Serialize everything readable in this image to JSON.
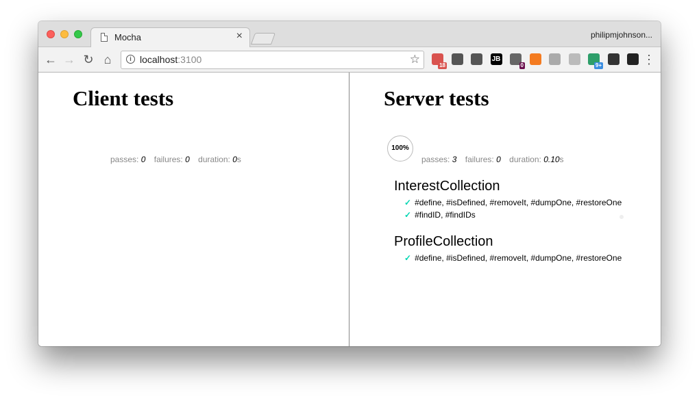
{
  "browser": {
    "tab_title": "Mocha",
    "tab_close": "×",
    "profile_name": "philipmjohnson...",
    "url_host": "localhost",
    "url_port": ":3100",
    "nav": {
      "back": "←",
      "forward": "→",
      "reload": "↻",
      "home": "⌂"
    },
    "star": "☆",
    "menu": "⋮",
    "extensions": [
      {
        "name": "ext-1-icon",
        "badge": "18",
        "color": "#d9534f"
      },
      {
        "name": "ext-2-icon",
        "badge": "",
        "color": "#555555"
      },
      {
        "name": "ext-3-icon",
        "badge": "",
        "color": "#555555"
      },
      {
        "name": "ext-4-icon",
        "label": "JB",
        "badge": "",
        "color": "#000000"
      },
      {
        "name": "ext-5-icon",
        "badge": "0",
        "color": "#666666"
      },
      {
        "name": "ext-6-icon",
        "badge": "",
        "color": "#f47b20"
      },
      {
        "name": "ext-7-icon",
        "badge": "",
        "color": "#aaaaaa"
      },
      {
        "name": "ext-8-icon",
        "badge": "",
        "color": "#bbbbbb"
      },
      {
        "name": "ext-9-icon",
        "badge": "9+",
        "color": "#2e9e6a"
      },
      {
        "name": "ext-10-icon",
        "badge": "",
        "color": "#333333"
      },
      {
        "name": "ext-11-icon",
        "badge": "",
        "color": "#222222"
      }
    ]
  },
  "client": {
    "title": "Client tests",
    "stats": {
      "passes_label": "passes:",
      "passes": "0",
      "failures_label": "failures:",
      "failures": "0",
      "duration_label": "duration:",
      "duration": "0",
      "duration_unit": "s"
    }
  },
  "server": {
    "title": "Server tests",
    "progress": "100%",
    "stats": {
      "passes_label": "passes:",
      "passes": "3",
      "failures_label": "failures:",
      "failures": "0",
      "duration_label": "duration:",
      "duration": "0.10",
      "duration_unit": "s"
    },
    "suites": [
      {
        "title": "InterestCollection",
        "tests": [
          "#define, #isDefined, #removeIt, #dumpOne, #restoreOne",
          "#findID, #findIDs"
        ]
      },
      {
        "title": "ProfileCollection",
        "tests": [
          "#define, #isDefined, #removeIt, #dumpOne, #restoreOne"
        ]
      }
    ],
    "check_mark": "✓"
  }
}
